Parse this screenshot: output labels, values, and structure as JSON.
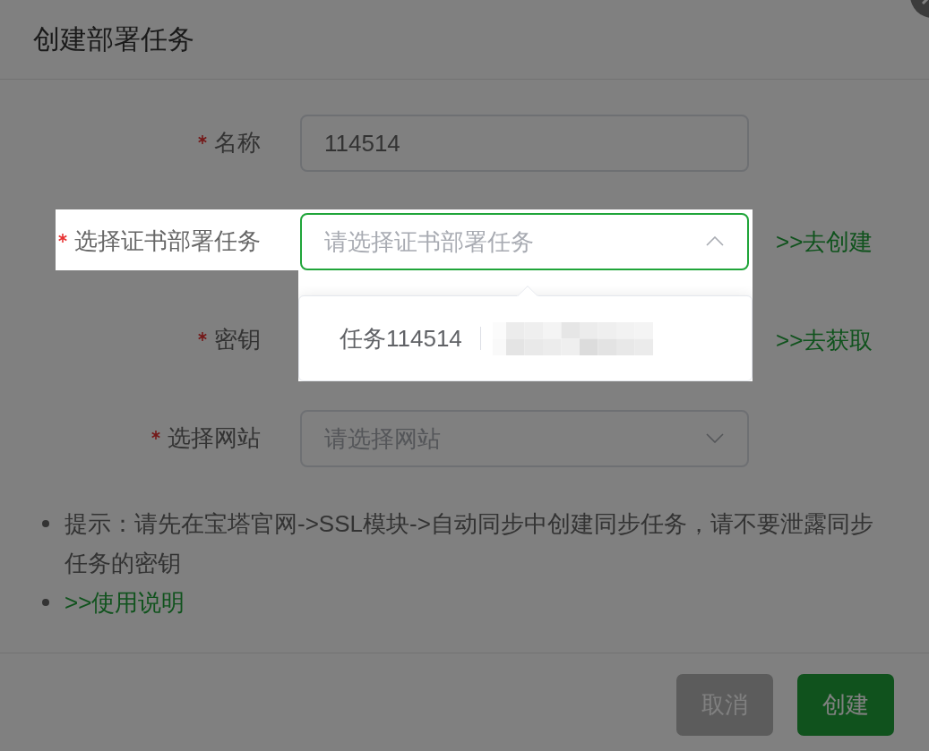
{
  "overlay": {
    "on": true
  },
  "dialog": {
    "title": "创建部署任务"
  },
  "form": {
    "fields": [
      {
        "kind": "input",
        "label": "名称",
        "required": true,
        "highlighted": false,
        "focused": false,
        "value": "114514"
      },
      {
        "kind": "select",
        "label": "选择证书部署任务",
        "required": true,
        "highlighted": true,
        "focused": true,
        "expanded": true,
        "placeholder": "请选择证书部署任务",
        "link": ">>去创建",
        "options": [
          {
            "label": "任务114514",
            "selected": false
          }
        ]
      },
      {
        "kind": "covered",
        "label": "密钥",
        "required": true,
        "highlighted": false,
        "link": ">>去获取"
      },
      {
        "kind": "select",
        "label": "选择网站",
        "required": true,
        "highlighted": false,
        "focused": false,
        "expanded": false,
        "placeholder": "请选择网站"
      }
    ]
  },
  "notes": [
    {
      "kind": "text",
      "text": "提示：请先在宝塔官网->SSL模块->自动同步中创建同步任务，请不要泄露同步任务的密钥"
    },
    {
      "kind": "link",
      "text": ">>使用说明"
    }
  ],
  "buttons": [
    {
      "kind": "cancel",
      "label": "取消"
    },
    {
      "kind": "primary",
      "label": "创建"
    }
  ]
}
